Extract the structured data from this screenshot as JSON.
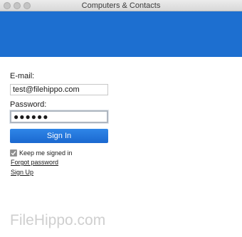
{
  "window": {
    "title": "Computers & Contacts"
  },
  "colors": {
    "banner": "#1d6fd0",
    "button": "#1f72d8"
  },
  "form": {
    "email_label": "E-mail:",
    "email_value": "test@filehippo.com",
    "password_label": "Password:",
    "password_value": "●●●●●●",
    "signin_label": "Sign In",
    "keep_signed_in_label": "Keep me signed in",
    "keep_signed_in_checked": true,
    "forgot_password_label": "Forgot password",
    "sign_up_label": "Sign Up"
  },
  "icons": {
    "close": "close-icon",
    "minimize": "minimize-icon",
    "zoom": "zoom-icon",
    "checkmark": "checkmark-icon"
  },
  "watermark": {
    "text": "FileHippo.com"
  }
}
